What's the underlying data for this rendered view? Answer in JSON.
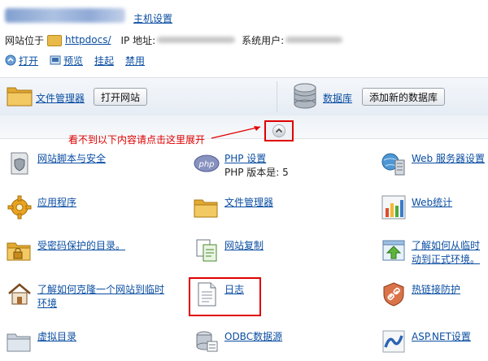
{
  "header": {
    "host_settings_link": "主机设置",
    "site_location_label": "网站位于",
    "folder_link": "httpdocs/",
    "ip_label": "IP 地址:",
    "system_user_label": "系统用户:"
  },
  "actions": [
    {
      "label": "打开",
      "icon": "open-icon"
    },
    {
      "label": "预览",
      "icon": "preview-icon"
    },
    {
      "label": "挂起",
      "icon": ""
    },
    {
      "label": "禁用",
      "icon": ""
    }
  ],
  "toolbar": {
    "file_manager_link": "文件管理器",
    "open_site_button": "打开网站",
    "database_link": "数据库",
    "add_database_button": "添加新的数据库"
  },
  "annotation": {
    "hint_text": "看不到以下内容请点击这里展开",
    "color": "#e00000"
  },
  "grid": {
    "col1": [
      {
        "label": "网站脚本与安全",
        "icon": "script-security-icon"
      },
      {
        "label": "应用程序",
        "icon": "gear-icon"
      },
      {
        "label": "受密码保护的目录。",
        "icon": "locked-folder-icon"
      },
      {
        "label": "了解如何克隆一个网站到临时",
        "label2": "环境",
        "icon": "house-icon"
      },
      {
        "label": "虚拟目录",
        "icon": "folder-icon"
      }
    ],
    "col2": [
      {
        "label": "PHP 设置",
        "sub": "PHP 版本是: 5",
        "icon": "php-icon"
      },
      {
        "label": "文件管理器",
        "icon": "folder-icon"
      },
      {
        "label": "网站复制",
        "icon": "copy-icon"
      },
      {
        "label": "日志",
        "icon": "log-document-icon"
      },
      {
        "label": "ODBC数据源",
        "icon": "odbc-icon"
      }
    ],
    "col3": [
      {
        "label": "Web 服务器设置",
        "icon": "web-server-icon"
      },
      {
        "label": "Web统计",
        "icon": "statistics-chart-icon"
      },
      {
        "label": "了解如何从临时",
        "label2": "动到正式环境。",
        "icon": "upload-arrow-icon"
      },
      {
        "label": "热链接防护",
        "icon": "hotlink-protection-icon"
      },
      {
        "label": "ASP.NET设置",
        "icon": "aspnet-icon"
      }
    ]
  }
}
